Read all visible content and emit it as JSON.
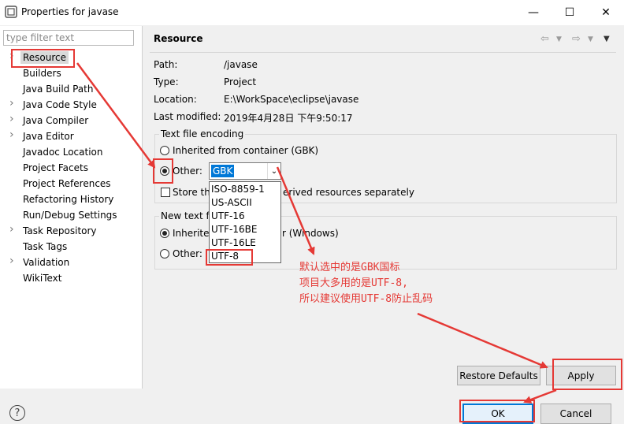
{
  "window": {
    "title": "Properties for javase"
  },
  "filter": {
    "placeholder": "type filter text"
  },
  "tree": [
    {
      "label": "Resource",
      "arrow": true,
      "selected": true
    },
    {
      "label": "Builders",
      "arrow": false
    },
    {
      "label": "Java Build Path",
      "arrow": false
    },
    {
      "label": "Java Code Style",
      "arrow": true
    },
    {
      "label": "Java Compiler",
      "arrow": true
    },
    {
      "label": "Java Editor",
      "arrow": true
    },
    {
      "label": "Javadoc Location",
      "arrow": false
    },
    {
      "label": "Project Facets",
      "arrow": false
    },
    {
      "label": "Project References",
      "arrow": false
    },
    {
      "label": "Refactoring History",
      "arrow": false
    },
    {
      "label": "Run/Debug Settings",
      "arrow": false
    },
    {
      "label": "Task Repository",
      "arrow": true
    },
    {
      "label": "Task Tags",
      "arrow": false
    },
    {
      "label": "Validation",
      "arrow": true
    },
    {
      "label": "WikiText",
      "arrow": false
    }
  ],
  "page": {
    "title": "Resource",
    "path_label": "Path:",
    "path_value": "/javase",
    "type_label": "Type:",
    "type_value": "Project",
    "location_label": "Location:",
    "location_value": "E:\\WorkSpace\\eclipse\\javase",
    "modified_label": "Last modified:",
    "modified_value": "2019年4月28日 下午9:50:17"
  },
  "encoding": {
    "group_title": "Text file encoding",
    "inherited_label": "Inherited from container (GBK)",
    "other_label": "Other:",
    "combo_value": "GBK",
    "options": [
      "ISO-8859-1",
      "US-ASCII",
      "UTF-16",
      "UTF-16BE",
      "UTF-16LE",
      "UTF-8"
    ],
    "store_prefix": "Store th",
    "store_suffix": "erived resources separately"
  },
  "delimiter": {
    "group_title_prefix": "New text fi",
    "inherited_prefix": "Inherite",
    "inherited_suffix": "r (Windows)",
    "other_label": "Other:"
  },
  "annotation": {
    "line1": "默认选中的是GBK国标",
    "line2": "项目大多用的是UTF-8,",
    "line3": "所以建议使用UTF-8防止乱码"
  },
  "buttons": {
    "restore": "Restore Defaults",
    "apply": "Apply",
    "ok": "OK",
    "cancel": "Cancel",
    "help": "?"
  },
  "colors": {
    "annotation": "#e53935",
    "selection": "#0078d7"
  }
}
